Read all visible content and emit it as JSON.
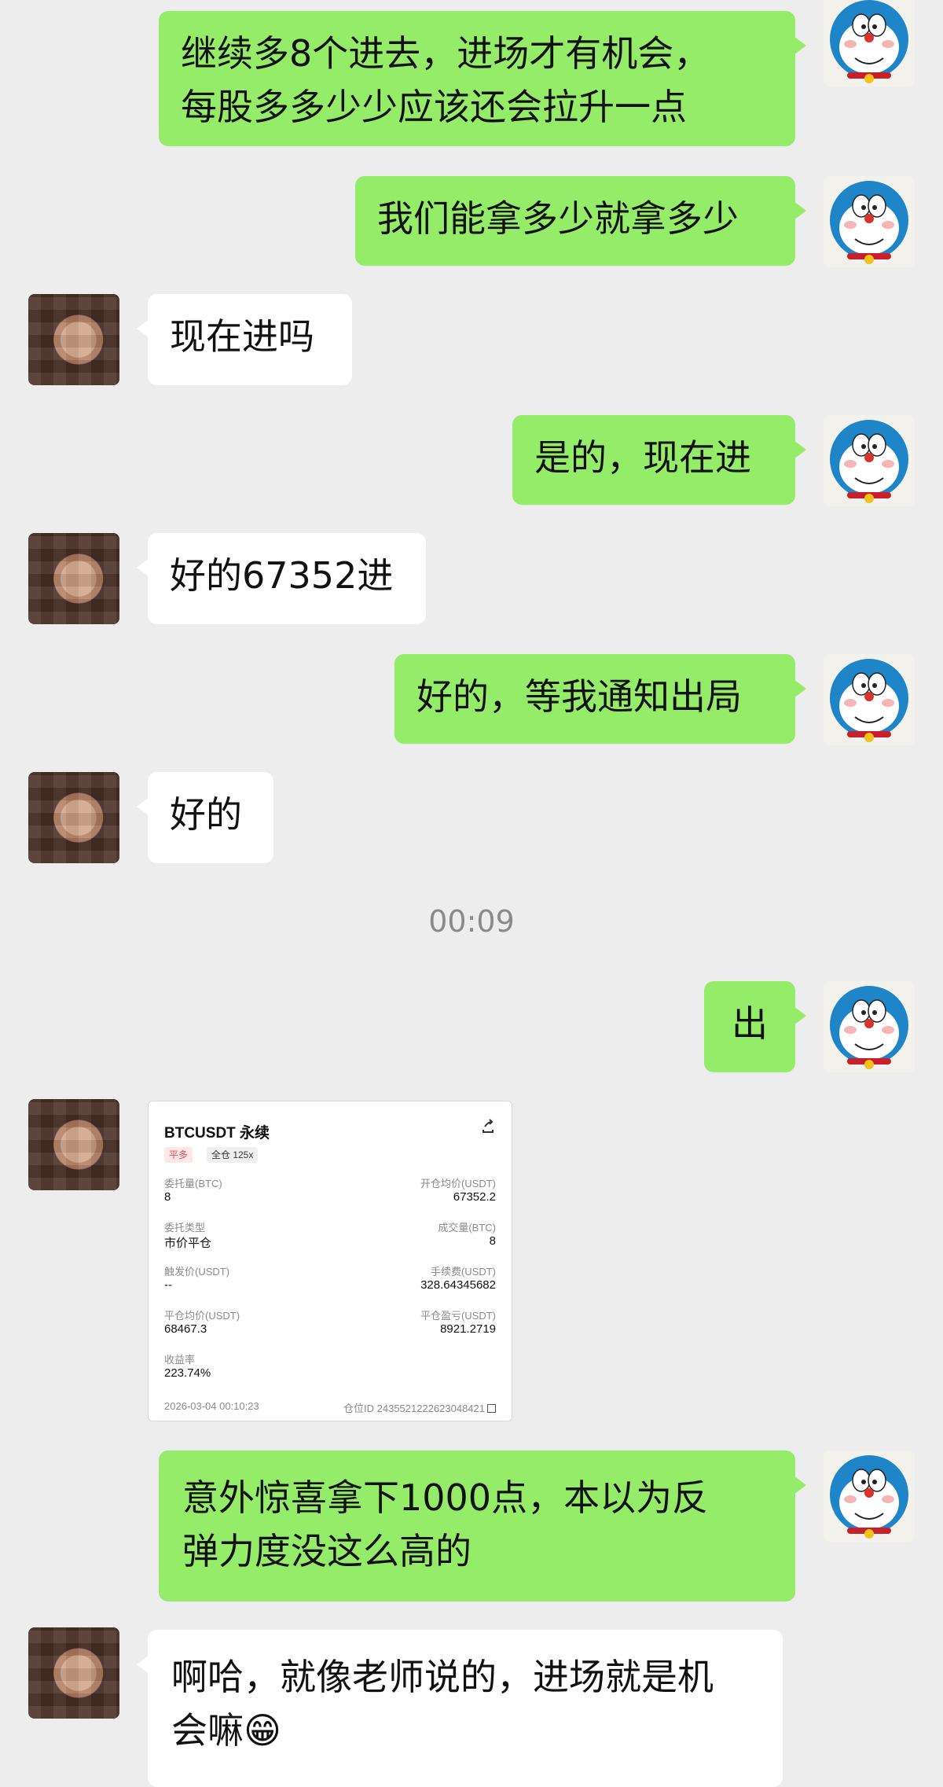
{
  "messages": [
    {
      "from": "me",
      "text": "继续多8个进去，进场才有机会，\n每股多多少少应该还会拉升一点"
    },
    {
      "from": "me",
      "text": "我们能拿多少就拿多少"
    },
    {
      "from": "other",
      "text": "现在进吗"
    },
    {
      "from": "me",
      "text": "是的，现在进"
    },
    {
      "from": "other",
      "text": "好的67352进"
    },
    {
      "from": "me",
      "text": "好的，等我通知出局"
    },
    {
      "from": "other",
      "text": "好的"
    },
    {
      "from": "me",
      "text": "出"
    },
    {
      "from": "me",
      "text": "意外惊喜拿下1000点，本以为反\n弹力度没这么高的"
    },
    {
      "from": "other",
      "text": "啊哈，就像老师说的，进场就是机\n会嘛😁"
    }
  ],
  "timestamp": "00:09",
  "trade_card": {
    "title": "BTCUSDT 永续",
    "share_icon": "share-icon",
    "tags": [
      "平多",
      "全仓 125x"
    ],
    "fields": [
      {
        "label": "委托量(BTC)",
        "value": "8"
      },
      {
        "label": "开仓均价(USDT)",
        "value": "67352.2"
      },
      {
        "label": "委托类型",
        "value": "市价平仓"
      },
      {
        "label": "成交量(BTC)",
        "value": "8"
      },
      {
        "label": "触发价(USDT)",
        "value": "--"
      },
      {
        "label": "手续费(USDT)",
        "value": "328.64345682"
      },
      {
        "label": "平仓均价(USDT)",
        "value": "68467.3"
      },
      {
        "label": "平仓盈亏(USDT)",
        "value": "8921.2719"
      },
      {
        "label": "收益率",
        "value": "223.74%"
      }
    ],
    "datetime": "2026-03-04 00:10:23",
    "position_id": "仓位ID 2435521222623048421"
  },
  "colors": {
    "background": "#ededed",
    "my_bubble": "#95ec69",
    "other_bubble": "#ffffff",
    "timestamp": "#8a8a8a",
    "tag_red": "#e05050"
  },
  "avatars": {
    "me": "doraemon-avatar-icon",
    "other": "blurred-person-avatar"
  }
}
